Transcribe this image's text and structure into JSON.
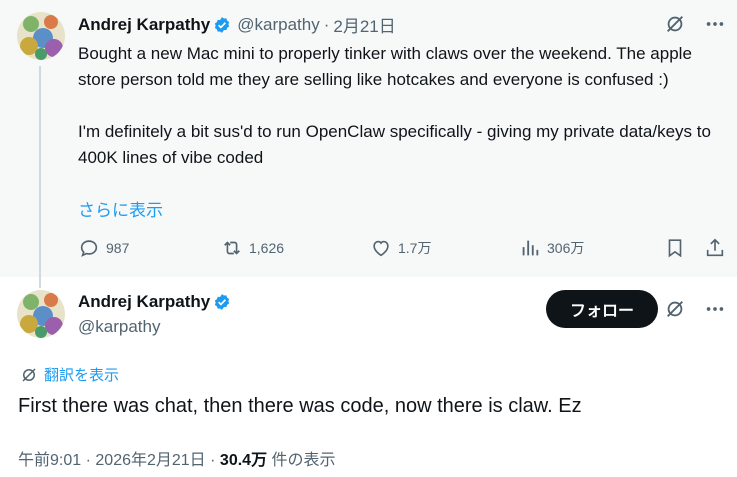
{
  "parent_tweet": {
    "author_name": "Andrej Karpathy",
    "handle": "@karpathy",
    "separator": "·",
    "date": "2月21日",
    "text": "Bought a new Mac mini to properly tinker with claws over the weekend. The apple store person told me they are selling like hotcakes and everyone is confused :)\n\nI'm definitely a bit sus'd to run OpenClaw specifically - giving my private data/keys to 400K lines of vibe coded",
    "show_more": "さらに表示",
    "replies": "987",
    "reposts": "1,626",
    "likes": "1.7万",
    "views": "306万"
  },
  "main_tweet": {
    "author_name": "Andrej Karpathy",
    "handle": "@karpathy",
    "follow_label": "フォロー",
    "translate_label": "翻訳を表示",
    "text": "First there was chat, then there was code, now there is claw. Ez",
    "time": "午前9:01",
    "dot": "·",
    "date": "2026年2月21日",
    "view_count": "30.4万",
    "view_suffix": " 件の表示"
  },
  "colors": {
    "accent": "#1d9bf0",
    "text": "#0f1419",
    "muted": "#536471",
    "parent_bg": "#f7f9f9",
    "follow_bg": "#0f1419"
  },
  "icons": [
    "verified-badge-icon",
    "grok-icon",
    "more-icon",
    "reply-icon",
    "repost-icon",
    "like-icon",
    "views-icon",
    "bookmark-icon",
    "share-icon",
    "translate-icon"
  ]
}
